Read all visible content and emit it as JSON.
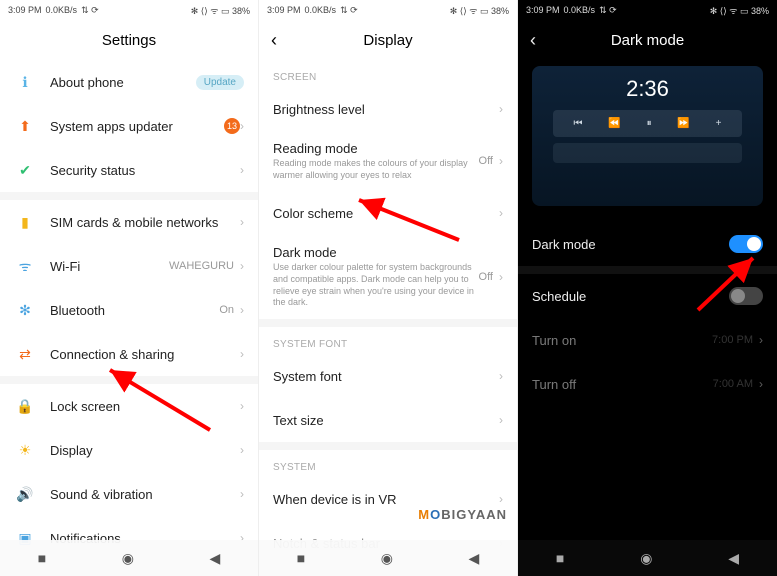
{
  "status": {
    "time": "3:09 PM",
    "net": "0.0KB/s",
    "icons": "⇅ ⟳",
    "right": "✻ ⟨⟩ ᯤ ▭ 38%"
  },
  "p1": {
    "title": "Settings",
    "items": [
      {
        "icon": "ℹ",
        "iconColor": "#5ab4e6",
        "label": "About phone",
        "pill": "Update"
      },
      {
        "icon": "⬆",
        "iconColor": "#f36b1b",
        "label": "System apps updater",
        "badge": "13"
      },
      {
        "icon": "✔",
        "iconColor": "#2fbf71",
        "label": "Security status"
      },
      {
        "icon": "▮",
        "iconColor": "#f3b61b",
        "label": "SIM cards & mobile networks"
      },
      {
        "icon": "ᯤ",
        "iconColor": "#4aa3e0",
        "label": "Wi-Fi",
        "meta": "WAHEGURU"
      },
      {
        "icon": "✻",
        "iconColor": "#4aa3e0",
        "label": "Bluetooth",
        "meta": "On"
      },
      {
        "icon": "⇄",
        "iconColor": "#f36b1b",
        "label": "Connection & sharing"
      },
      {
        "icon": "🔒",
        "iconColor": "#e0544f",
        "label": "Lock screen"
      },
      {
        "icon": "☀",
        "iconColor": "#f3b61b",
        "label": "Display"
      },
      {
        "icon": "🔊",
        "iconColor": "#2fbf71",
        "label": "Sound & vibration"
      },
      {
        "icon": "▣",
        "iconColor": "#4aa3e0",
        "label": "Notifications"
      }
    ]
  },
  "p2": {
    "title": "Display",
    "sections": {
      "screen": "SCREEN",
      "font": "SYSTEM FONT",
      "system": "SYSTEM"
    },
    "items": {
      "brightness": {
        "label": "Brightness level"
      },
      "reading": {
        "label": "Reading mode",
        "sub": "Reading mode makes the colours of your display warmer allowing your eyes to relax",
        "meta": "Off"
      },
      "colorscheme": {
        "label": "Color scheme"
      },
      "darkmode": {
        "label": "Dark mode",
        "sub": "Use darker colour palette for system backgrounds and compatible apps. Dark mode can help you to relieve eye strain when you're using your device in the dark.",
        "meta": "Off"
      },
      "sysfont": {
        "label": "System font"
      },
      "textsize": {
        "label": "Text size"
      },
      "vr": {
        "label": "When device is in VR"
      },
      "notch": {
        "label": "Notch & status bar"
      }
    },
    "watermark": {
      "m": "M",
      "o": "O",
      "rest": "BIGYAAN"
    }
  },
  "p3": {
    "title": "Dark mode",
    "preview_time": "2:36",
    "rows": {
      "darkmode": {
        "label": "Dark mode",
        "on": true
      },
      "schedule": {
        "label": "Schedule",
        "on": false
      },
      "turnon": {
        "label": "Turn on",
        "meta": "7:00 PM"
      },
      "turnoff": {
        "label": "Turn off",
        "meta": "7:00 AM"
      }
    }
  }
}
